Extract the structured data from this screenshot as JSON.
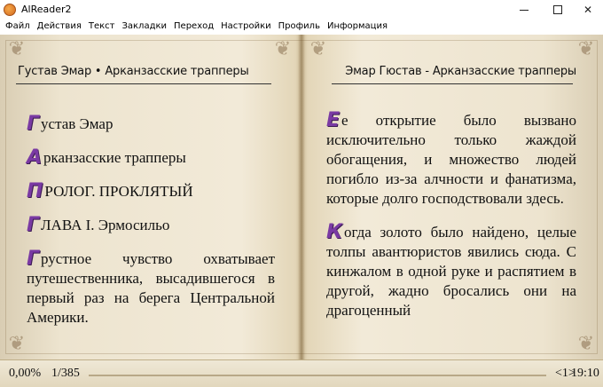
{
  "window": {
    "title": "AlReader2",
    "icon": "app-logo-icon"
  },
  "menu": [
    {
      "label": "Файл"
    },
    {
      "label": "Действия"
    },
    {
      "label": "Текст"
    },
    {
      "label": "Закладки"
    },
    {
      "label": "Переход"
    },
    {
      "label": "Настройки"
    },
    {
      "label": "Профиль"
    },
    {
      "label": "Информация"
    }
  ],
  "book": {
    "left_header": "Густав Эмар • Арканзасские трапперы",
    "right_header": "Эмар Гюстав - Арканзасские трапперы",
    "left_page": [
      {
        "cap": "Г",
        "text": "устав Эмар"
      },
      {
        "cap": "А",
        "text": "рканзасские трапперы"
      },
      {
        "cap": "П",
        "text": "РОЛОГ. ПРОКЛЯТЫЙ"
      },
      {
        "cap": "Г",
        "text": "ЛАВА I. Эрмосильо"
      },
      {
        "cap": "Г",
        "text": "рустное чувство охватывает путешественника, высадившегося в первый раз на берега Центральной Америки."
      }
    ],
    "right_page": [
      {
        "cap": "Е",
        "text": "е открытие было вызвано исключительно только жаждой обогащения, и множество людей погибло из-за алчности и фанатизма, которые долго господствовали здесь."
      },
      {
        "cap": "К",
        "text": "огда золото было найдено, целые толпы авантюристов явились сюда. С кинжалом в одной руке и распятием в другой, жадно бросались они на драгоценный"
      }
    ],
    "cap_color": "#7a3aa3"
  },
  "status": {
    "percent": "0,00%",
    "page": "1/385",
    "progress_fraction": 0.0,
    "nav": "<1>",
    "time": "19:10"
  }
}
